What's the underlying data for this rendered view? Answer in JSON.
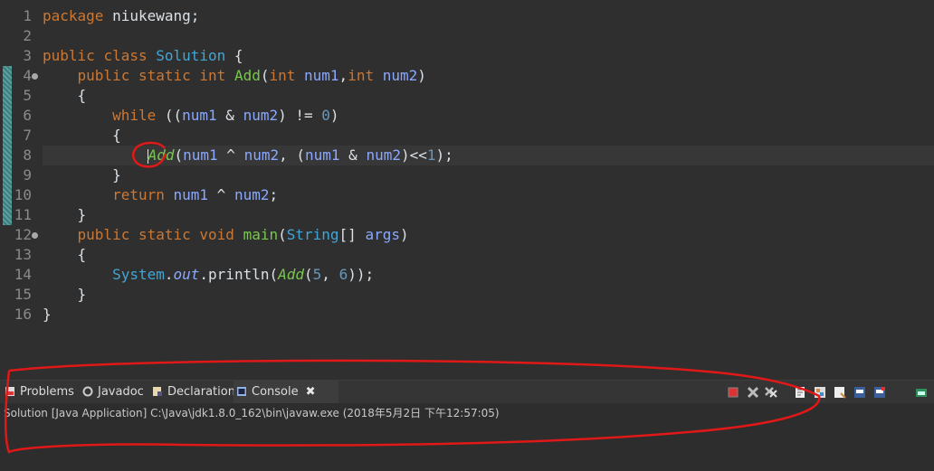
{
  "editor": {
    "lines": [
      {
        "no": "1",
        "tokens": [
          {
            "t": "package ",
            "c": "kw"
          },
          {
            "t": "niukewang;",
            "c": "punct"
          }
        ]
      },
      {
        "no": "2",
        "tokens": []
      },
      {
        "no": "3",
        "tokens": [
          {
            "t": "public ",
            "c": "kw"
          },
          {
            "t": "class ",
            "c": "kw"
          },
          {
            "t": "Solution",
            "c": "cls"
          },
          {
            "t": " {",
            "c": "punct"
          }
        ]
      },
      {
        "no": "4",
        "tokens": [
          {
            "t": "    public ",
            "c": "kw"
          },
          {
            "t": "static ",
            "c": "kw"
          },
          {
            "t": "int ",
            "c": "kw"
          },
          {
            "t": "Add",
            "c": "fn"
          },
          {
            "t": "(",
            "c": "punct"
          },
          {
            "t": "int ",
            "c": "kw"
          },
          {
            "t": "num1",
            "c": "var"
          },
          {
            "t": ",",
            "c": "punct"
          },
          {
            "t": "int ",
            "c": "kw"
          },
          {
            "t": "num2",
            "c": "var"
          },
          {
            "t": ")",
            "c": "punct"
          }
        ]
      },
      {
        "no": "5",
        "tokens": [
          {
            "t": "    {",
            "c": "punct"
          }
        ]
      },
      {
        "no": "6",
        "tokens": [
          {
            "t": "        while ",
            "c": "kw"
          },
          {
            "t": "((",
            "c": "punct"
          },
          {
            "t": "num1",
            "c": "var"
          },
          {
            "t": " & ",
            "c": "punct"
          },
          {
            "t": "num2",
            "c": "var"
          },
          {
            "t": ") != ",
            "c": "punct"
          },
          {
            "t": "0",
            "c": "num"
          },
          {
            "t": ")",
            "c": "punct"
          }
        ]
      },
      {
        "no": "7",
        "tokens": [
          {
            "t": "        {",
            "c": "punct"
          }
        ]
      },
      {
        "no": "8",
        "tokens": [
          {
            "t": "            ",
            "c": "punct"
          },
          {
            "t": "|",
            "c": "cursor"
          },
          {
            "t": "Add",
            "c": "fn it"
          },
          {
            "t": "(",
            "c": "punct"
          },
          {
            "t": "num1",
            "c": "var"
          },
          {
            "t": " ^ ",
            "c": "punct"
          },
          {
            "t": "num2",
            "c": "var"
          },
          {
            "t": ", (",
            "c": "punct"
          },
          {
            "t": "num1",
            "c": "var"
          },
          {
            "t": " & ",
            "c": "punct"
          },
          {
            "t": "num2",
            "c": "var"
          },
          {
            "t": ")<<",
            "c": "punct"
          },
          {
            "t": "1",
            "c": "num"
          },
          {
            "t": ");",
            "c": "punct"
          }
        ]
      },
      {
        "no": "9",
        "tokens": [
          {
            "t": "        }",
            "c": "punct"
          }
        ]
      },
      {
        "no": "10",
        "tokens": [
          {
            "t": "        return ",
            "c": "kw"
          },
          {
            "t": "num1",
            "c": "var"
          },
          {
            "t": " ^ ",
            "c": "punct"
          },
          {
            "t": "num2",
            "c": "var"
          },
          {
            "t": ";",
            "c": "punct"
          }
        ]
      },
      {
        "no": "11",
        "tokens": [
          {
            "t": "    }",
            "c": "punct"
          }
        ]
      },
      {
        "no": "12",
        "tokens": [
          {
            "t": "    public ",
            "c": "kw"
          },
          {
            "t": "static ",
            "c": "kw"
          },
          {
            "t": "void ",
            "c": "kw"
          },
          {
            "t": "main",
            "c": "fn"
          },
          {
            "t": "(",
            "c": "punct"
          },
          {
            "t": "String",
            "c": "cls"
          },
          {
            "t": "[] ",
            "c": "punct"
          },
          {
            "t": "args",
            "c": "var"
          },
          {
            "t": ")",
            "c": "punct"
          }
        ]
      },
      {
        "no": "13",
        "tokens": [
          {
            "t": "    {",
            "c": "punct"
          }
        ]
      },
      {
        "no": "14",
        "tokens": [
          {
            "t": "        System",
            "c": "cls"
          },
          {
            "t": ".",
            "c": "punct"
          },
          {
            "t": "out",
            "c": "var it"
          },
          {
            "t": ".println(",
            "c": "punct"
          },
          {
            "t": "Add",
            "c": "fn it"
          },
          {
            "t": "(",
            "c": "punct"
          },
          {
            "t": "5",
            "c": "num"
          },
          {
            "t": ", ",
            "c": "punct"
          },
          {
            "t": "6",
            "c": "num"
          },
          {
            "t": "));",
            "c": "punct"
          }
        ]
      },
      {
        "no": "15",
        "tokens": [
          {
            "t": "    }",
            "c": "punct"
          }
        ]
      },
      {
        "no": "16",
        "tokens": [
          {
            "t": "}",
            "c": "punct"
          }
        ]
      }
    ]
  },
  "tabs": [
    {
      "label": "Problems",
      "icon": "problems-icon"
    },
    {
      "label": "Javadoc",
      "icon": "javadoc-icon"
    },
    {
      "label": "Declaration",
      "icon": "declaration-icon"
    },
    {
      "label": "Console",
      "icon": "console-icon",
      "active": true,
      "close": "✖"
    }
  ],
  "console": {
    "status": "Solution [Java Application] C:\\Java\\jdk1.8.0_162\\bin\\javaw.exe (2018年5月2日 下午12:57:05)"
  }
}
